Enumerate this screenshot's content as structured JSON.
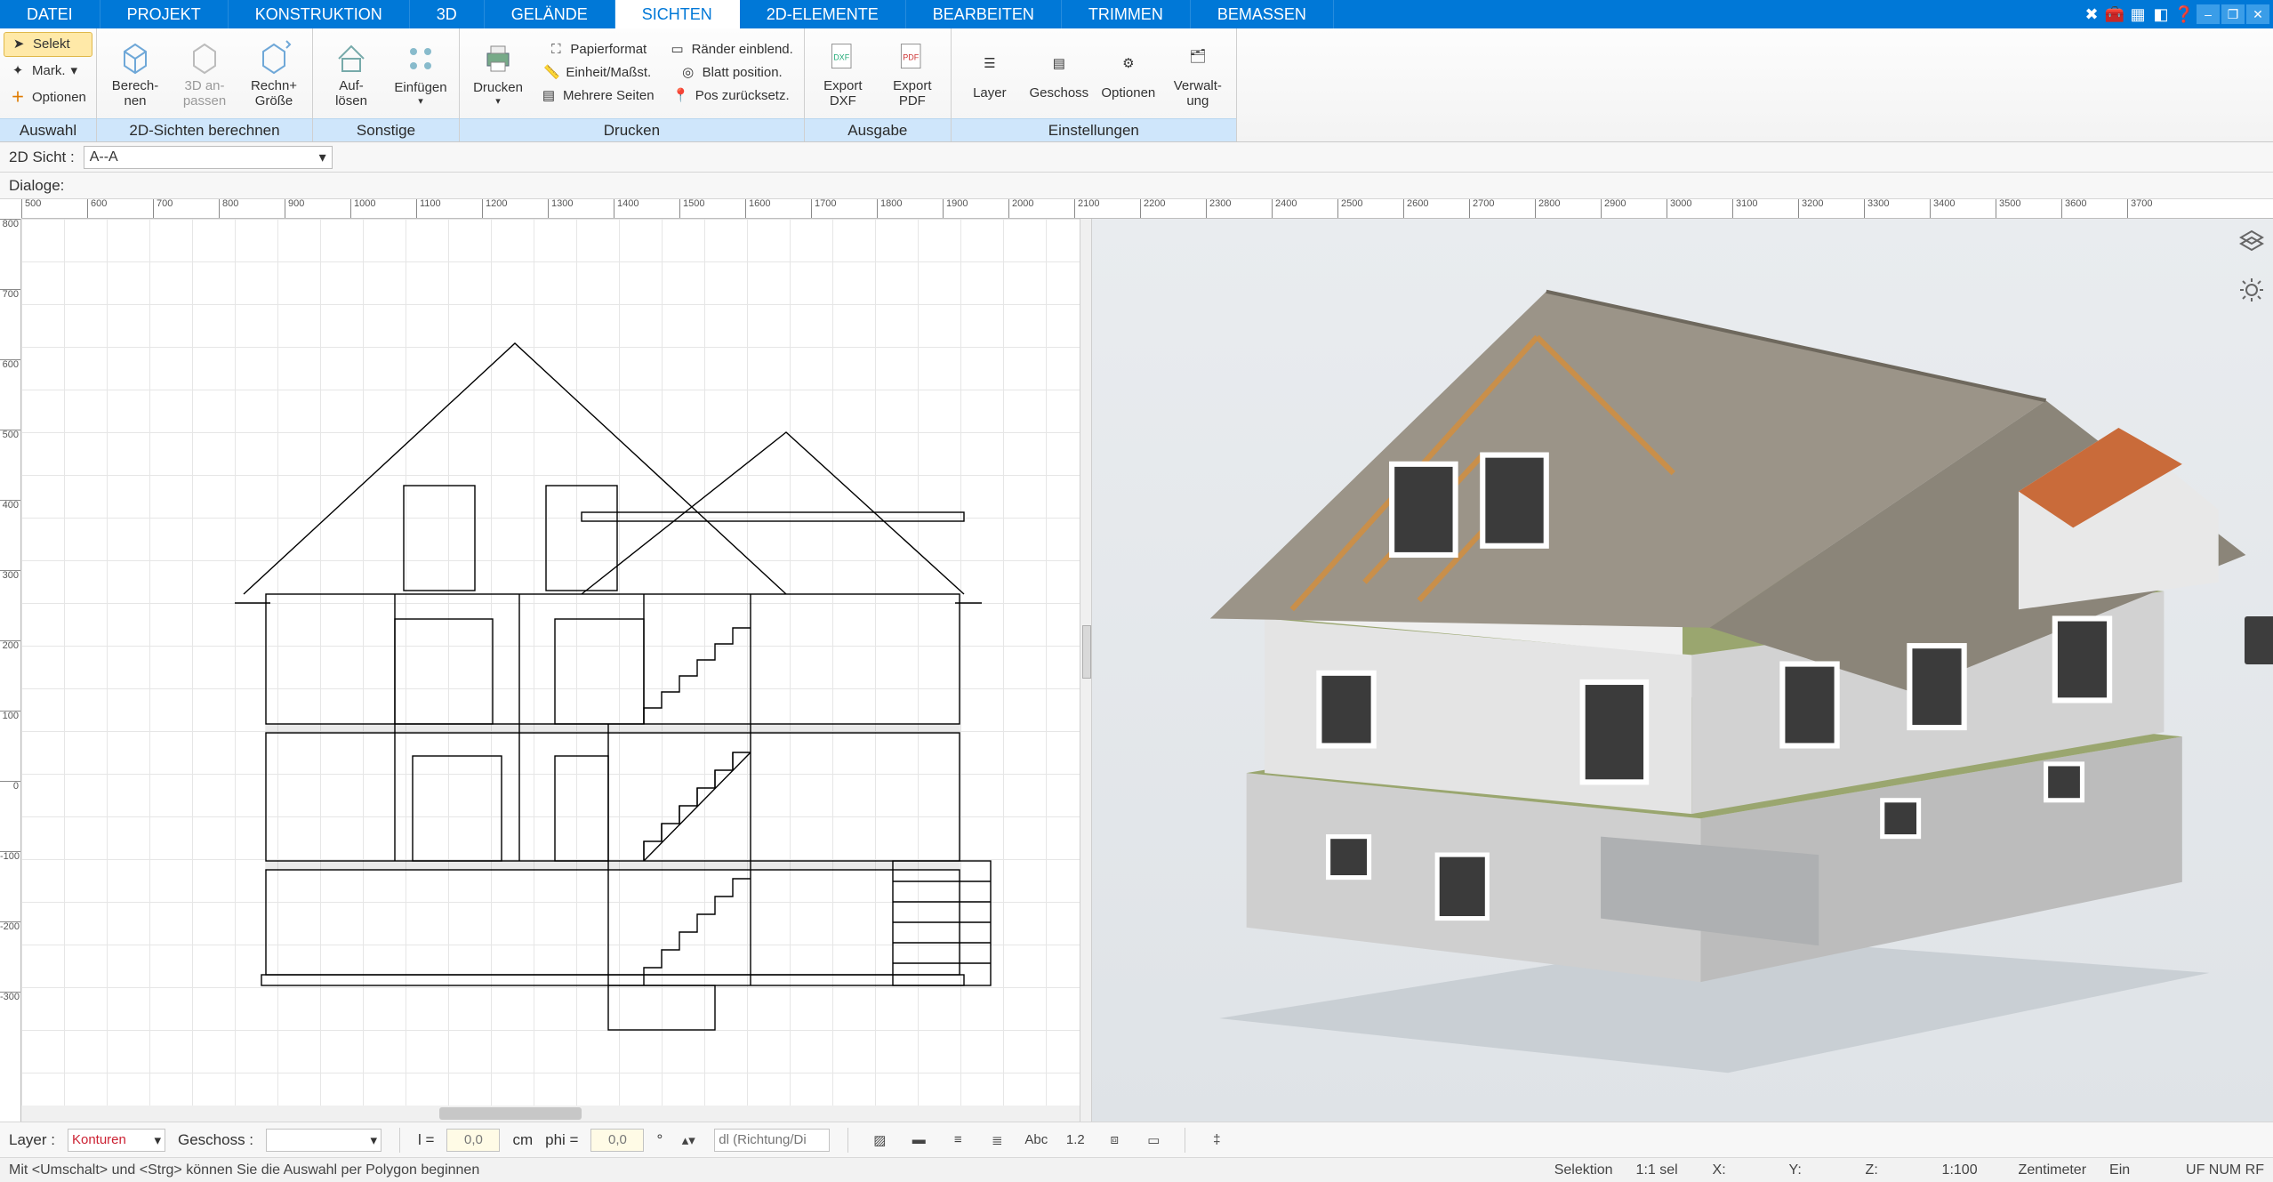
{
  "menu": {
    "tabs": [
      "DATEI",
      "PROJEKT",
      "KONSTRUKTION",
      "3D",
      "GELÄNDE",
      "SICHTEN",
      "2D-ELEMENTE",
      "BEARBEITEN",
      "TRIMMEN",
      "BEMASSEN"
    ],
    "active": "SICHTEN"
  },
  "ribbon": {
    "groups": {
      "auswahl": {
        "label": "Auswahl",
        "selekt": "Selekt",
        "mark": "Mark.",
        "optionen": "Optionen"
      },
      "sichten": {
        "label": "2D-Sichten berechnen",
        "berechnen": "Berech-\nnen",
        "anpassen": "3D an-\npassen",
        "rechngroesse": "Rechn+\nGröße"
      },
      "sonstige": {
        "label": "Sonstige",
        "aufloesen": "Auf-\nlösen",
        "einfuegen": "Einfügen"
      },
      "drucken": {
        "label": "Drucken",
        "drucken": "Drucken",
        "papier": "Papierformat",
        "einheit": "Einheit/Maßst.",
        "mehrere": "Mehrere Seiten",
        "raender": "Ränder einblend.",
        "blatt": "Blatt position.",
        "pos": "Pos zurücksetz."
      },
      "ausgabe": {
        "label": "Ausgabe",
        "dxf": "Export\nDXF",
        "pdf": "Export\nPDF"
      },
      "einstellungen": {
        "label": "Einstellungen",
        "layer": "Layer",
        "geschoss": "Geschoss",
        "optionen": "Optionen",
        "verwaltung": "Verwalt-\nung"
      }
    }
  },
  "viewbar": {
    "label": "2D Sicht :",
    "value": "A--A"
  },
  "dialoge": {
    "label": "Dialoge:"
  },
  "ruler_h": {
    "start": 500,
    "step": 100,
    "count": 33
  },
  "ruler_v": {
    "values": [
      "800",
      "700",
      "600",
      "500",
      "400",
      "300",
      "200",
      "100",
      "0",
      "-100",
      "-200",
      "-300"
    ]
  },
  "bottom": {
    "layer_label": "Layer :",
    "layer_value": "Konturen",
    "geschoss_label": "Geschoss :",
    "l_label": "l =",
    "l_value": "0,0",
    "l_unit": "cm",
    "phi_label": "phi =",
    "phi_value": "0,0",
    "phi_unit": "°",
    "dl_placeholder": "dl (Richtung/Di"
  },
  "status": {
    "hint": "Mit <Umschalt> und <Strg> können Sie die Auswahl per Polygon beginnen",
    "selection": "Selektion",
    "ratio": "1:1 sel",
    "x": "X:",
    "y": "Y:",
    "z": "Z:",
    "scale": "1:100",
    "unit": "Zentimeter",
    "ein": "Ein",
    "caps": "UF  NUM  RF"
  }
}
